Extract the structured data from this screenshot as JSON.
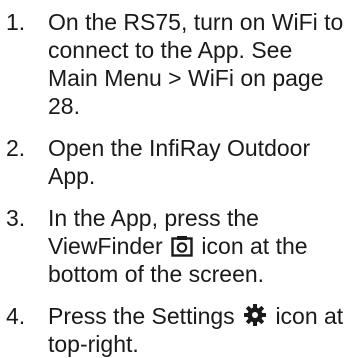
{
  "steps": [
    {
      "number": "1.",
      "text": "On the RS75, turn on WiFi to connect to the App. See Main Menu > WiFi on page 28."
    },
    {
      "number": "2.",
      "text": "Open the InfiRay Outdoor App."
    },
    {
      "number": "3.",
      "text_before": "In the App, press the ViewFinder",
      "icon": "viewfinder-camera-icon",
      "text_after": "icon at the bottom of the screen."
    },
    {
      "number": "4.",
      "text_before": "Press the Settings",
      "icon": "gear-icon",
      "text_after": "icon at top-right."
    }
  ]
}
